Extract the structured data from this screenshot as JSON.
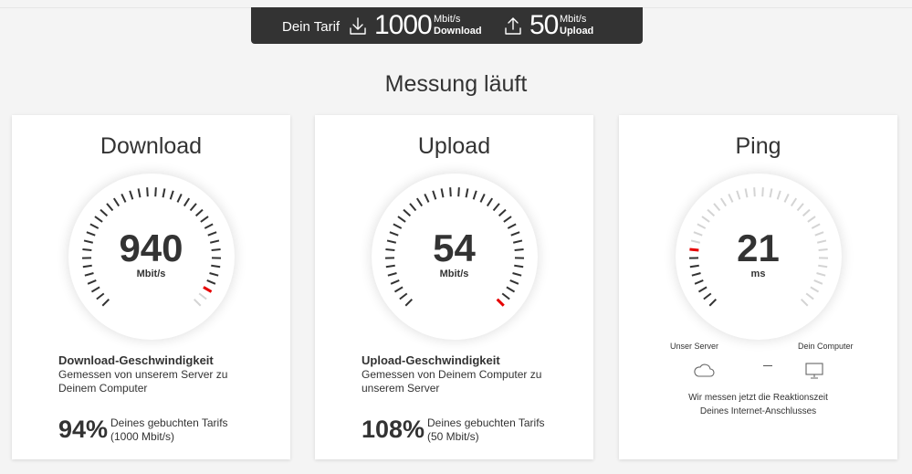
{
  "header": {
    "tarif_label": "Dein Tarif",
    "download_value": "1000",
    "download_unit": "Mbit/s",
    "download_label": "Download",
    "upload_value": "50",
    "upload_unit": "Mbit/s",
    "upload_label": "Upload"
  },
  "page": {
    "title": "Messung läuft"
  },
  "accent_color": "#e60000",
  "download": {
    "title": "Download",
    "value": "940",
    "unit": "Mbit/s",
    "needle_fraction": 0.94,
    "info_title": "Download-Geschwindigkeit",
    "info_desc": "Gemessen von unserem Server zu Deinem Computer",
    "percent": "94%",
    "percent_line1": "Deines gebuchten Tarifs",
    "percent_line2": "(1000 Mbit/s)"
  },
  "upload": {
    "title": "Upload",
    "value": "54",
    "unit": "Mbit/s",
    "needle_fraction": 1.0,
    "info_title": "Upload-Geschwindigkeit",
    "info_desc": "Gemessen von Deinem Computer zu unserem Server",
    "percent": "108%",
    "percent_line1": "Deines gebuchten Tarifs",
    "percent_line2": "(50 Mbit/s)"
  },
  "ping": {
    "title": "Ping",
    "value": "21",
    "unit": "ms",
    "needle_fraction": 0.2,
    "server_label": "Unser Server",
    "computer_label": "Dein Computer",
    "server_icon": "cloud-icon",
    "computer_icon": "monitor-icon",
    "text_line1": "Wir messen jetzt die Reaktionszeit",
    "text_line2": "Deines Internet-Anschlusses"
  }
}
